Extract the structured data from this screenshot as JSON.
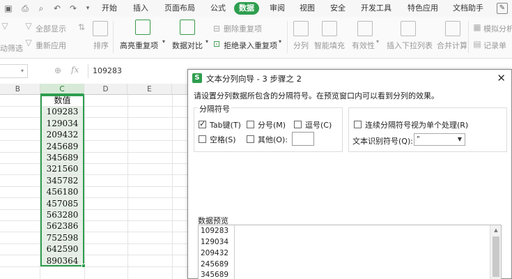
{
  "menubar": {
    "quick_icons": [
      "save-icon",
      "print-icon",
      "preview-icon",
      "undo-icon",
      "redo-icon",
      "dropdown-icon"
    ],
    "tabs": [
      "开始",
      "插入",
      "页面布局",
      "公式",
      "数据",
      "审阅",
      "视图",
      "安全",
      "开发工具",
      "特色应用",
      "文档助手"
    ],
    "active_tab": "数据"
  },
  "ribbon": {
    "filter_show_all": "全部显示",
    "filter_reapply": "重新应用",
    "filter_left": "筛选",
    "filter_left2": "动筛选",
    "sort": "排序",
    "highlight_dup": "高亮重复项",
    "data_compare": "数据对比",
    "remove_dup": "删除重复项",
    "reject_dup": "拒绝录入重复项",
    "split": "分列",
    "smart_fill": "智能填充",
    "validity": "有效性",
    "insert_dropdown": "插入下拉列表",
    "merge_calc": "合并计算",
    "simulate": "模拟分析",
    "record": "记录单"
  },
  "formula_bar": {
    "fx": "fx",
    "value": "109283"
  },
  "sheet": {
    "columns": [
      "B",
      "C",
      "D",
      "E"
    ],
    "header_cell": "数值",
    "values": [
      "109283",
      "129034",
      "209432",
      "245689",
      "345689",
      "321560",
      "345782",
      "456180",
      "457085",
      "563280",
      "562386",
      "752598",
      "642590",
      "890364"
    ]
  },
  "dialog": {
    "title": "文本分列向导 - 3 步骤之 2",
    "description": "请设置分列数据所包含的分隔符号。在预览窗口内可以看到分列的效果。",
    "delimiters_group": "分隔符号",
    "tab_label": "Tab键(T)",
    "semicolon_label": "分号(M)",
    "comma_label": "逗号(C)",
    "space_label": "空格(S)",
    "other_label": "其他(O):",
    "consecutive_label": "连续分隔符号视为单个处理(R)",
    "qualifier_label": "文本识别符号(Q):",
    "qualifier_value": "\"",
    "preview_label": "数据预览",
    "preview_lines": [
      "109283",
      "129034",
      "209432",
      "245689",
      "345689"
    ]
  }
}
